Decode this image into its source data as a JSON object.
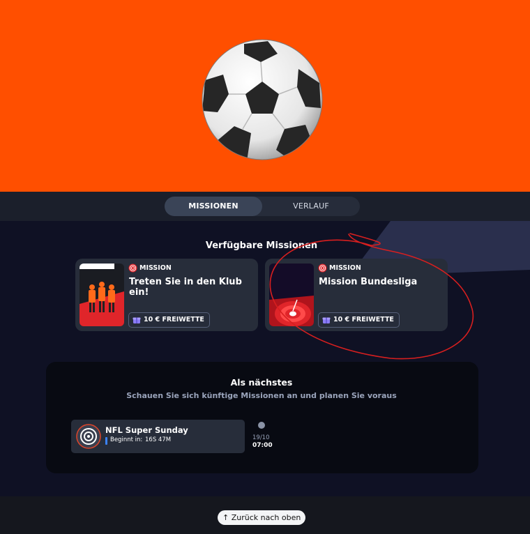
{
  "tabs": {
    "active": "MISSIONEN",
    "other": "VERLAUF"
  },
  "available": {
    "title": "Verfügbare Missionen",
    "cards": [
      {
        "tag": "MISSION",
        "title": "Treten Sie in den Klub ein!",
        "reward": "10 € FREIWETTE"
      },
      {
        "tag": "MISSION",
        "title": "Mission Bundesliga",
        "reward": "10 € FREIWETTE"
      }
    ]
  },
  "next": {
    "title": "Als nächstes",
    "subtitle": "Schauen Sie sich künftige Missionen an und planen Sie voraus",
    "event": {
      "title": "NFL Super Sunday",
      "begin_label": "Beginnt in:",
      "begin_time": "16S 47M"
    },
    "timeline": {
      "date": "19/10",
      "time": "07:00"
    }
  },
  "footer": {
    "back_to_top": "↑ Zurück nach oben"
  },
  "colors": {
    "hero": "#ff4f00",
    "accent_red": "#e0252a",
    "card": "#272d3a"
  },
  "icons": {
    "hero": "soccer-ball-icon",
    "mission": "target-icon",
    "reward": "gift-icon"
  }
}
